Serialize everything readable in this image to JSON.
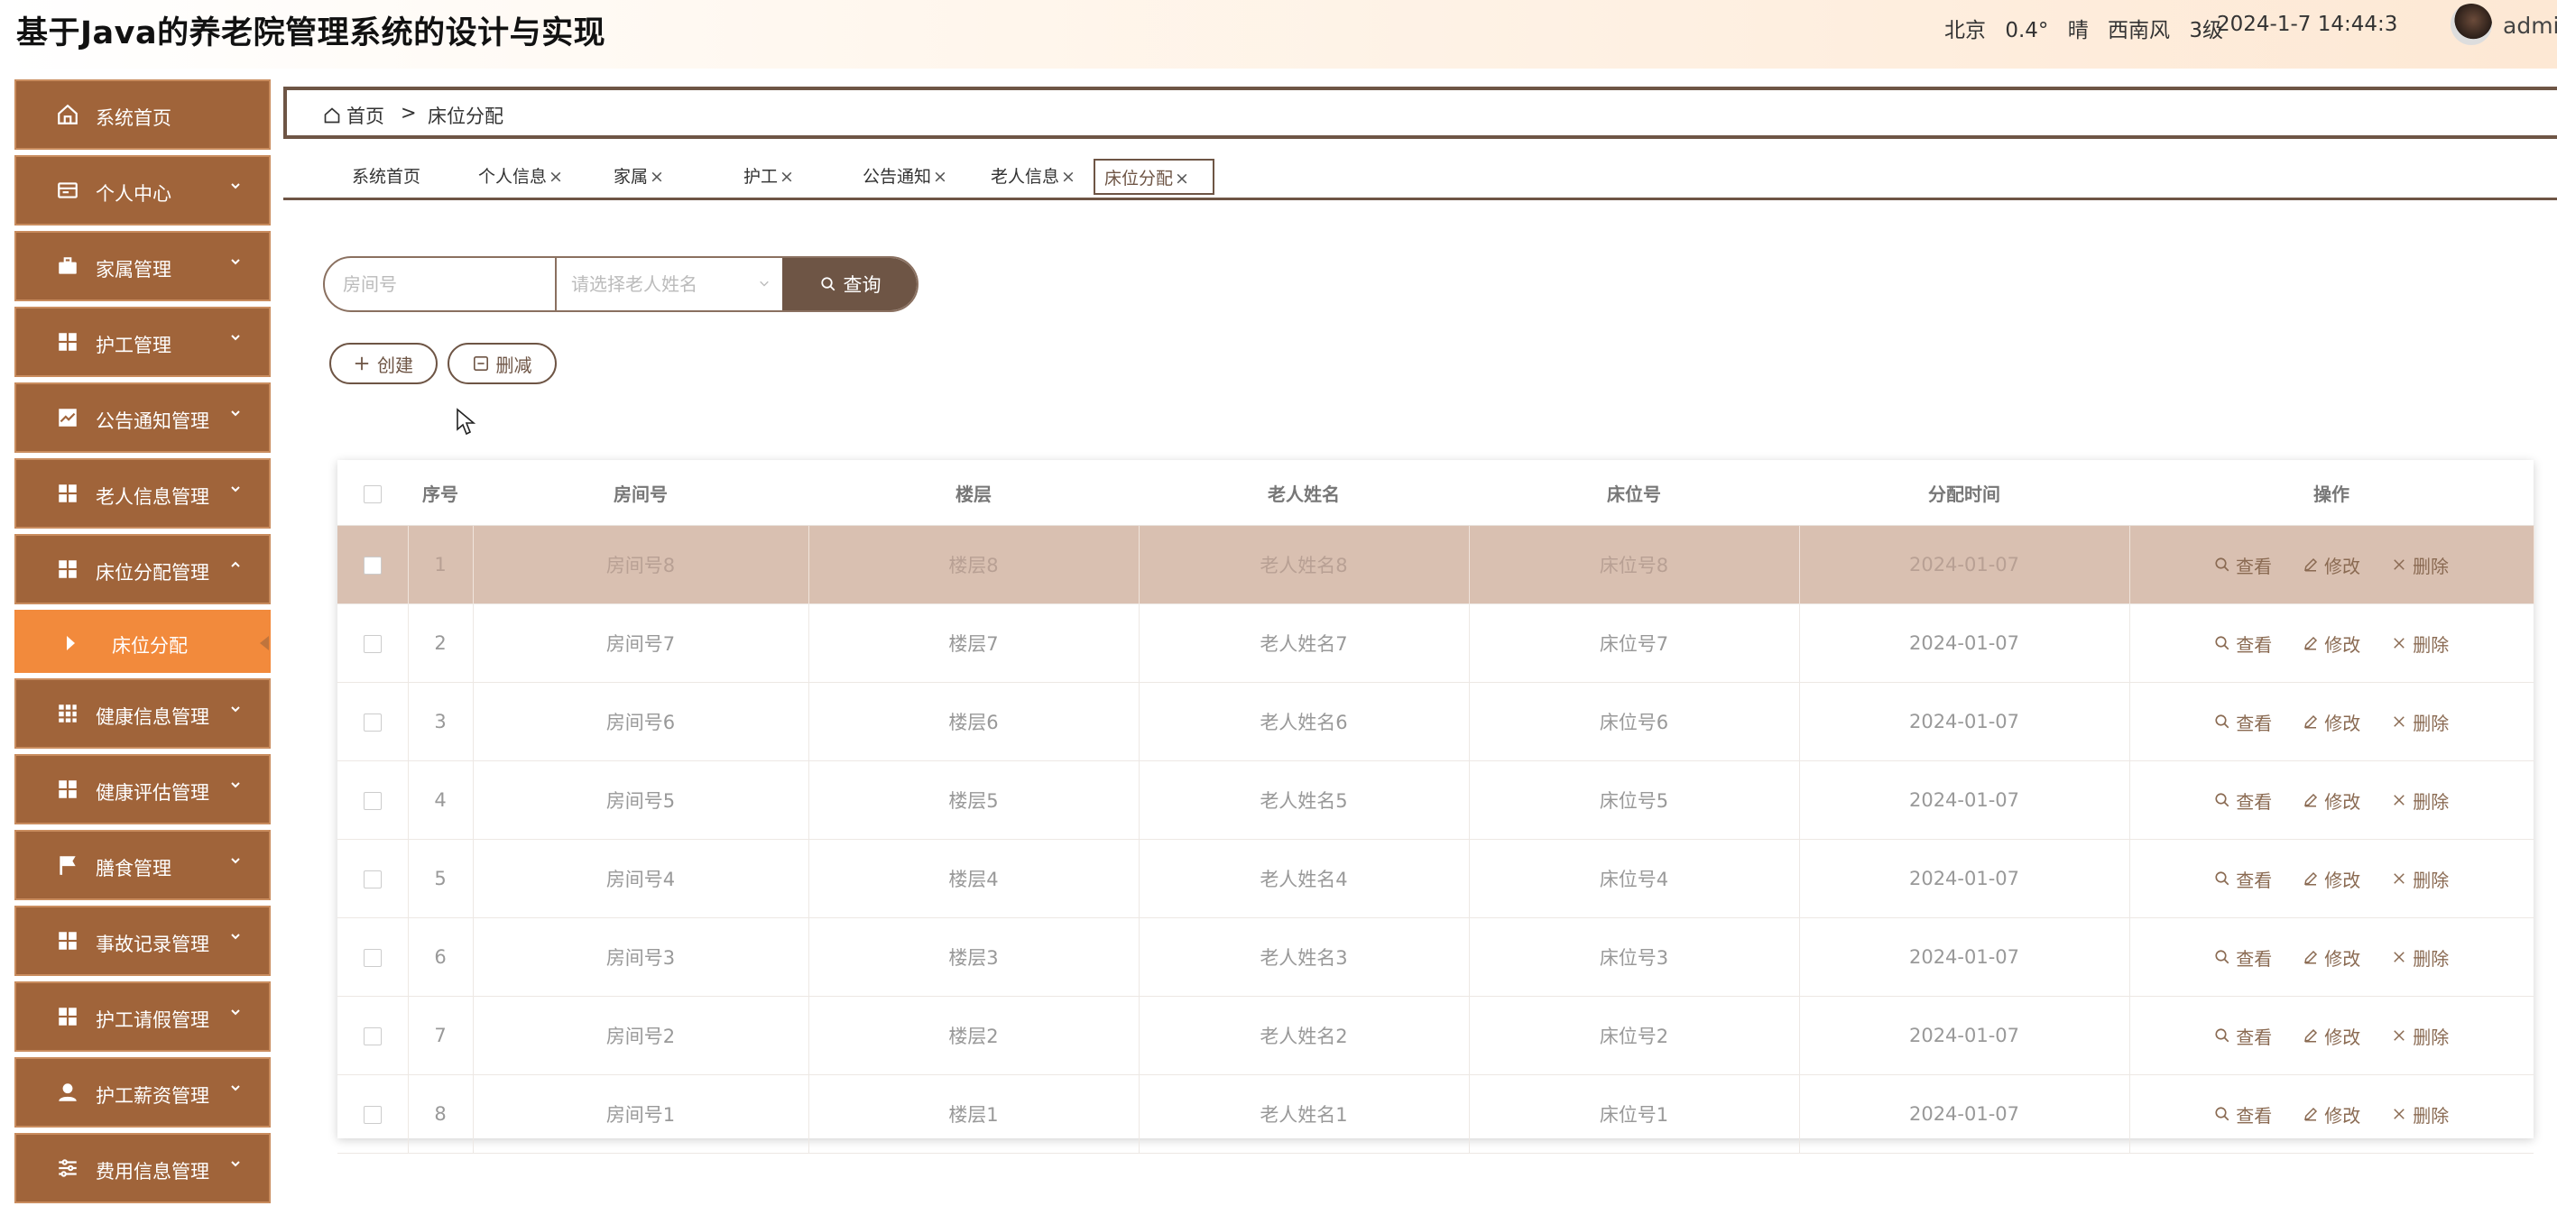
{
  "header": {
    "title": "基于Java的养老院管理系统的设计与实现",
    "weather": {
      "city": "北京",
      "temp": "0.4°",
      "condition": "晴",
      "wind": "西南风",
      "level": "3级"
    },
    "datetime": "2024-1-7 14:44:3",
    "username": "admin"
  },
  "sidebar": {
    "items": [
      {
        "label": "系统首页",
        "icon": "home-icon"
      },
      {
        "label": "个人中心",
        "icon": "id-card-icon"
      },
      {
        "label": "家属管理",
        "icon": "briefcase-icon"
      },
      {
        "label": "护工管理",
        "icon": "grid-icon"
      },
      {
        "label": "公告通知管理",
        "icon": "chart-icon"
      },
      {
        "label": "老人信息管理",
        "icon": "grid-icon"
      },
      {
        "label": "床位分配管理",
        "icon": "grid-icon"
      },
      {
        "label": "健康信息管理",
        "icon": "table-icon"
      },
      {
        "label": "健康评估管理",
        "icon": "grid-icon"
      },
      {
        "label": "膳食管理",
        "icon": "flag-icon"
      },
      {
        "label": "事故记录管理",
        "icon": "grid-icon"
      },
      {
        "label": "护工请假管理",
        "icon": "grid-icon"
      },
      {
        "label": "护工薪资管理",
        "icon": "user-icon"
      },
      {
        "label": "费用信息管理",
        "icon": "sliders-icon"
      }
    ],
    "sub_item": "床位分配"
  },
  "breadcrumb": {
    "home": "首页",
    "separator": ">",
    "current": "床位分配"
  },
  "tabs": [
    {
      "label": "系统首页",
      "close": ""
    },
    {
      "label": "个人信息",
      "close": "×"
    },
    {
      "label": "家属",
      "close": "×"
    },
    {
      "label": "护工",
      "close": "×"
    },
    {
      "label": "公告通知",
      "close": "×"
    },
    {
      "label": "老人信息",
      "close": "×"
    },
    {
      "label": "床位分配",
      "close": "×"
    }
  ],
  "search": {
    "room_placeholder": "房间号",
    "elder_placeholder": "请选择老人姓名",
    "query_label": "查询"
  },
  "actions": {
    "create_label": "创建",
    "delete_label": "删减"
  },
  "table": {
    "columns": [
      "序号",
      "房间号",
      "楼层",
      "老人姓名",
      "床位号",
      "分配时间",
      "操作"
    ],
    "op_labels": {
      "view": "查看",
      "edit": "修改",
      "delete": "删除"
    },
    "rows": [
      {
        "no": "1",
        "room": "房间号8",
        "floor": "楼层8",
        "name": "老人姓名8",
        "bed": "床位号8",
        "date": "2024-01-07"
      },
      {
        "no": "2",
        "room": "房间号7",
        "floor": "楼层7",
        "name": "老人姓名7",
        "bed": "床位号7",
        "date": "2024-01-07"
      },
      {
        "no": "3",
        "room": "房间号6",
        "floor": "楼层6",
        "name": "老人姓名6",
        "bed": "床位号6",
        "date": "2024-01-07"
      },
      {
        "no": "4",
        "room": "房间号5",
        "floor": "楼层5",
        "name": "老人姓名5",
        "bed": "床位号5",
        "date": "2024-01-07"
      },
      {
        "no": "5",
        "room": "房间号4",
        "floor": "楼层4",
        "name": "老人姓名4",
        "bed": "床位号4",
        "date": "2024-01-07"
      },
      {
        "no": "6",
        "room": "房间号3",
        "floor": "楼层3",
        "name": "老人姓名3",
        "bed": "床位号3",
        "date": "2024-01-07"
      },
      {
        "no": "7",
        "room": "房间号2",
        "floor": "楼层2",
        "name": "老人姓名2",
        "bed": "床位号2",
        "date": "2024-01-07"
      },
      {
        "no": "8",
        "room": "房间号1",
        "floor": "楼层1",
        "name": "老人姓名1",
        "bed": "床位号1",
        "date": "2024-01-07"
      }
    ]
  },
  "colors": {
    "brand_brown": "#6e5545",
    "sidebar_item": "#a0643a",
    "sidebar_active": "#f28a3c",
    "row_highlight": "#d9c0b1"
  }
}
